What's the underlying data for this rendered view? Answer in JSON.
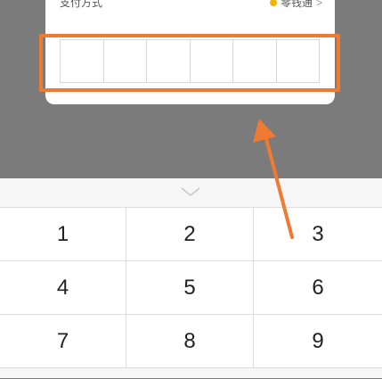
{
  "payment": {
    "label": "支付方式",
    "method": "零钱通",
    "chevron": ">"
  },
  "password": {
    "digits_count": 6
  },
  "keyboard": {
    "collapse_icon": "chevron-down-icon",
    "keys": [
      "1",
      "2",
      "3",
      "4",
      "5",
      "6",
      "7",
      "8",
      "9"
    ]
  },
  "annotation": {
    "color": "#ef7a31"
  }
}
